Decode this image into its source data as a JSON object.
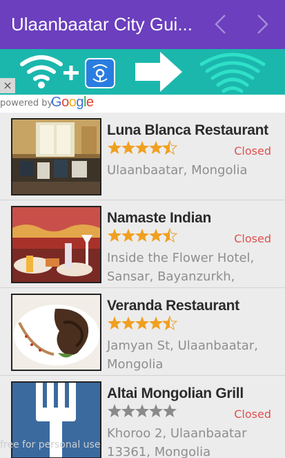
{
  "app_bar": {
    "title": "Ulaanbaatar City Gui...",
    "prev_icon": "chevron-left-icon",
    "next_icon": "chevron-right-icon",
    "color": "#6b3fbe"
  },
  "ad_banner": {
    "close_label": "×",
    "powered_by_label": "powered by",
    "google_logo": "Google",
    "color": "#1bb7ad"
  },
  "places": [
    {
      "name": "Luna Blanca Restaurant",
      "rating": 4.5,
      "status": "Closed",
      "address": "Ulaanbaatar, Mongolia",
      "stars_color": "#f0a020"
    },
    {
      "name": "Namaste Indian",
      "rating": 4.5,
      "status": "Closed",
      "address": "Inside the Flower Hotel, Sansar, Bayanzurkh,",
      "stars_color": "#f0a020"
    },
    {
      "name": "Veranda Restaurant",
      "rating": 4.5,
      "status": "",
      "address": "Jamyan St, Ulaanbaatar, Mongolia",
      "stars_color": "#f0a020"
    },
    {
      "name": "Altai Mongolian Grill",
      "rating": 0,
      "status": "Closed",
      "address": "Khoroo 2, Ulaanbaatar 13361, Mongolia",
      "stars_color": "#8a8a8a"
    }
  ],
  "watermark": "free for personal use"
}
